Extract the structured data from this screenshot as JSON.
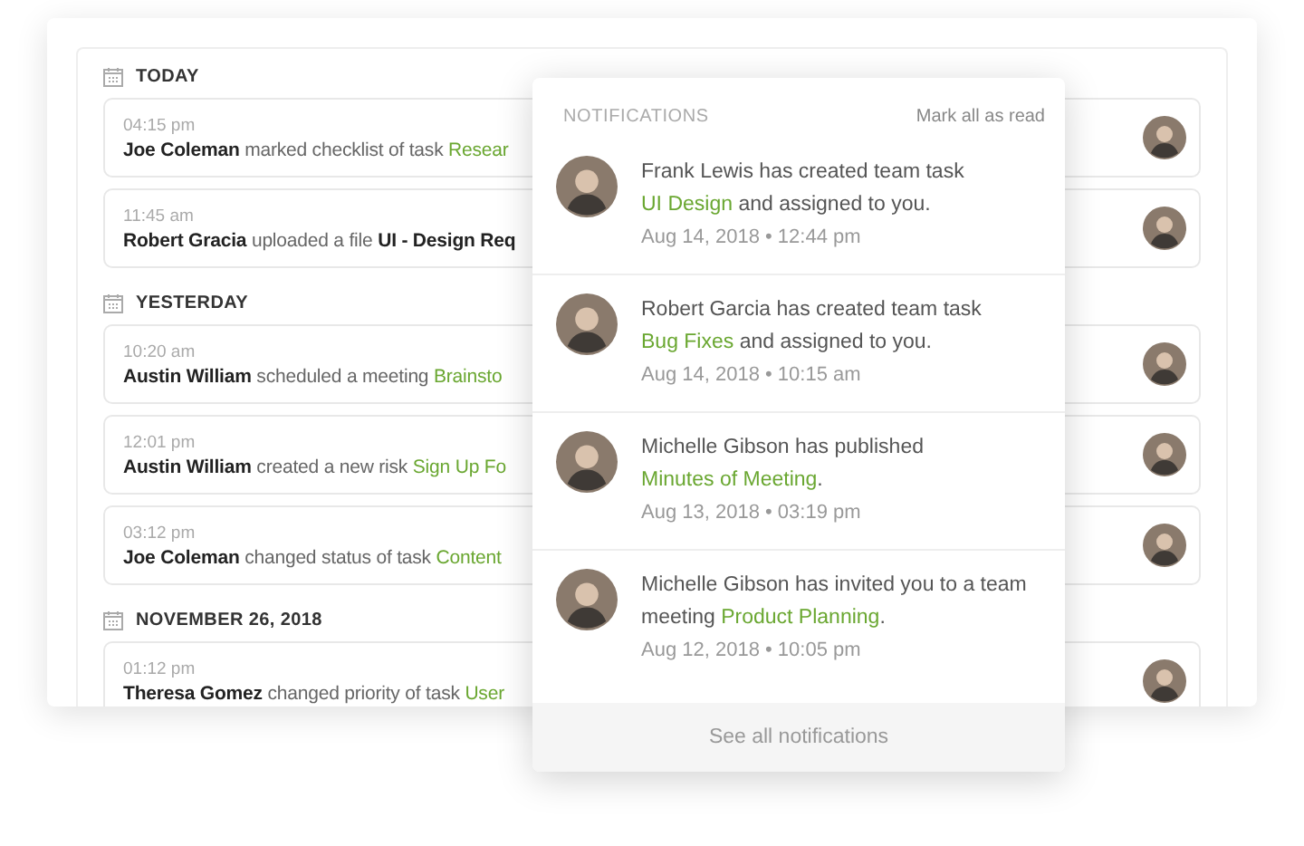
{
  "activity": {
    "sections": [
      {
        "label": "TODAY",
        "entries": [
          {
            "time": "04:15 pm",
            "actor": "Joe Coleman",
            "action": "marked checklist of task",
            "kind": "task",
            "target": "Resear"
          },
          {
            "time": "11:45 am",
            "actor": "Robert Gracia",
            "action": "uploaded a file",
            "kind": "file",
            "target": "UI - Design Req"
          }
        ]
      },
      {
        "label": "YESTERDAY",
        "entries": [
          {
            "time": "10:20 am",
            "actor": "Austin William",
            "action": "scheduled a meeting",
            "kind": "task",
            "target": "Brainsto"
          },
          {
            "time": "12:01 pm",
            "actor": "Austin William",
            "action": "created a new risk",
            "kind": "task",
            "target": "Sign Up Fo"
          },
          {
            "time": "03:12 pm",
            "actor": "Joe Coleman",
            "action": "changed status of task",
            "kind": "task",
            "target": "Content"
          }
        ]
      },
      {
        "label": "NOVEMBER 26, 2018",
        "entries": [
          {
            "time": "01:12 pm",
            "actor": "Theresa Gomez",
            "action": "changed priority of task",
            "kind": "task",
            "target": "User"
          }
        ]
      }
    ]
  },
  "notifications": {
    "title": "NOTIFICATIONS",
    "mark_all": "Mark all as read",
    "items": [
      {
        "before": "Frank Lewis has created team task ",
        "link": "UI Design",
        "after": " and assigned to you.",
        "date": "Aug 14, 2018 • 12:44 pm"
      },
      {
        "before": "Robert Garcia has created team task ",
        "link": "Bug Fixes",
        "after": " and assigned to you.",
        "date": "Aug 14, 2018 • 10:15 am"
      },
      {
        "before": "Michelle Gibson has published ",
        "link": "Minutes of Meeting",
        "after": ".",
        "date": "Aug 13, 2018 • 03:19 pm"
      },
      {
        "before": "Michelle Gibson has invited you to a team meeting ",
        "link": "Product Planning",
        "after": ".",
        "date": "Aug 12, 2018 • 10:05 pm"
      }
    ],
    "footer": "See all notifications"
  }
}
